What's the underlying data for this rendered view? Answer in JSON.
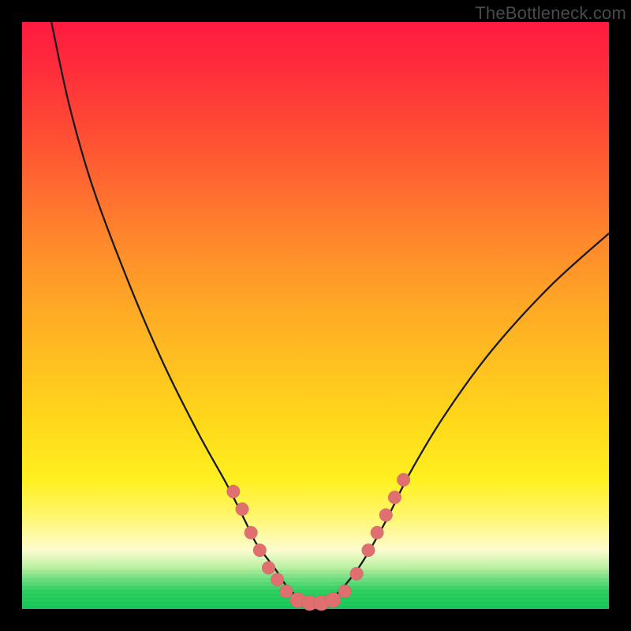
{
  "watermark": "TheBottleneck.com",
  "chart_data": {
    "type": "line",
    "title": "",
    "xlabel": "",
    "ylabel": "",
    "xlim": [
      0,
      100
    ],
    "ylim": [
      0,
      100
    ],
    "gradient_stops": [
      {
        "pos": 0.0,
        "color": "#ff1a40"
      },
      {
        "pos": 0.4,
        "color": "#ff8a2b"
      },
      {
        "pos": 0.7,
        "color": "#ffd81a"
      },
      {
        "pos": 0.88,
        "color": "#fff66a"
      },
      {
        "pos": 1.0,
        "color": "#18c858"
      }
    ],
    "series": [
      {
        "name": "bottleneck-curve",
        "x": [
          5,
          8,
          12,
          18,
          24,
          30,
          35,
          38,
          40,
          43,
          45,
          47,
          49,
          51,
          53,
          55,
          58,
          62,
          66,
          72,
          80,
          90,
          100
        ],
        "y": [
          100,
          86,
          72,
          56,
          42,
          30,
          21,
          15,
          11,
          7,
          4,
          2,
          1,
          1,
          2,
          4,
          8,
          15,
          23,
          33,
          44,
          55,
          64
        ]
      }
    ],
    "markers": {
      "name": "highlight-dots",
      "color": "#e07070",
      "points": [
        {
          "x": 36,
          "y": 20,
          "r": 1.2
        },
        {
          "x": 37.5,
          "y": 17,
          "r": 1.2
        },
        {
          "x": 39,
          "y": 13,
          "r": 1.2
        },
        {
          "x": 40.5,
          "y": 10,
          "r": 1.2
        },
        {
          "x": 42,
          "y": 7,
          "r": 1.2
        },
        {
          "x": 43.5,
          "y": 5,
          "r": 1.2
        },
        {
          "x": 45,
          "y": 3,
          "r": 1.2
        },
        {
          "x": 47,
          "y": 1.5,
          "r": 1.4
        },
        {
          "x": 49,
          "y": 1,
          "r": 1.4
        },
        {
          "x": 51,
          "y": 1,
          "r": 1.4
        },
        {
          "x": 53,
          "y": 1.5,
          "r": 1.4
        },
        {
          "x": 55,
          "y": 3,
          "r": 1.2
        },
        {
          "x": 57,
          "y": 6,
          "r": 1.2
        },
        {
          "x": 59,
          "y": 10,
          "r": 1.2
        },
        {
          "x": 60.5,
          "y": 13,
          "r": 1.2
        },
        {
          "x": 62,
          "y": 16,
          "r": 1.2
        },
        {
          "x": 63.5,
          "y": 19,
          "r": 1.2
        },
        {
          "x": 65,
          "y": 22,
          "r": 1.2
        }
      ]
    }
  }
}
